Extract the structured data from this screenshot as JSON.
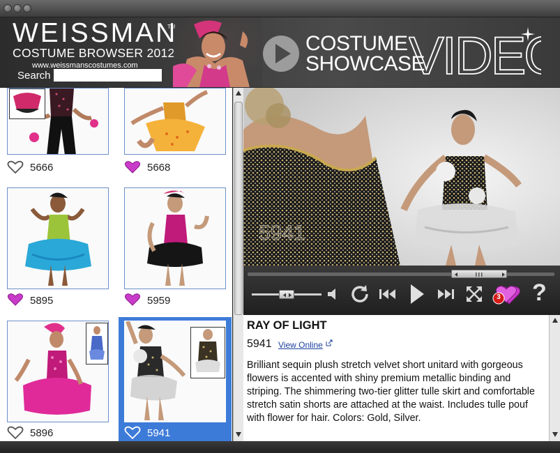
{
  "header": {
    "brand_name": "WEISSMAN",
    "brand_tm": "TM",
    "brand_sub": "COSTUME BROWSER 2012",
    "brand_url": "www.weissmanscostumes.com",
    "search_label": "Search",
    "search_value": "",
    "promo_line1": "COSTUME",
    "promo_line2": "SHOWCASE",
    "promo_video": "VIDEO"
  },
  "grid": {
    "items": [
      {
        "number": "5666",
        "favorite": false
      },
      {
        "number": "5668",
        "favorite": true
      },
      {
        "number": "5895",
        "favorite": true
      },
      {
        "number": "5959",
        "favorite": true
      },
      {
        "number": "5896",
        "favorite": false
      },
      {
        "number": "5941",
        "favorite": false,
        "selected": true
      }
    ]
  },
  "video": {
    "overlay_number": "5941"
  },
  "controls": {
    "favorites_count": "3",
    "help": "?"
  },
  "detail": {
    "title": "RAY OF LIGHT",
    "number": "5941",
    "view_online": "View Online",
    "description": "Brilliant sequin plush stretch velvet short unitard with gorgeous flowers is accented with shiny premium metallic binding and striping. The shimmering two-tier glitter tulle skirt and comfortable stretch satin shorts are attached at the waist. Includes tulle pouf with flower for hair. Colors: Gold, Silver."
  },
  "colors": {
    "selected": "#3d7bd9",
    "favorite": "#c93bc9",
    "tile_border": "#6a8fc9"
  }
}
